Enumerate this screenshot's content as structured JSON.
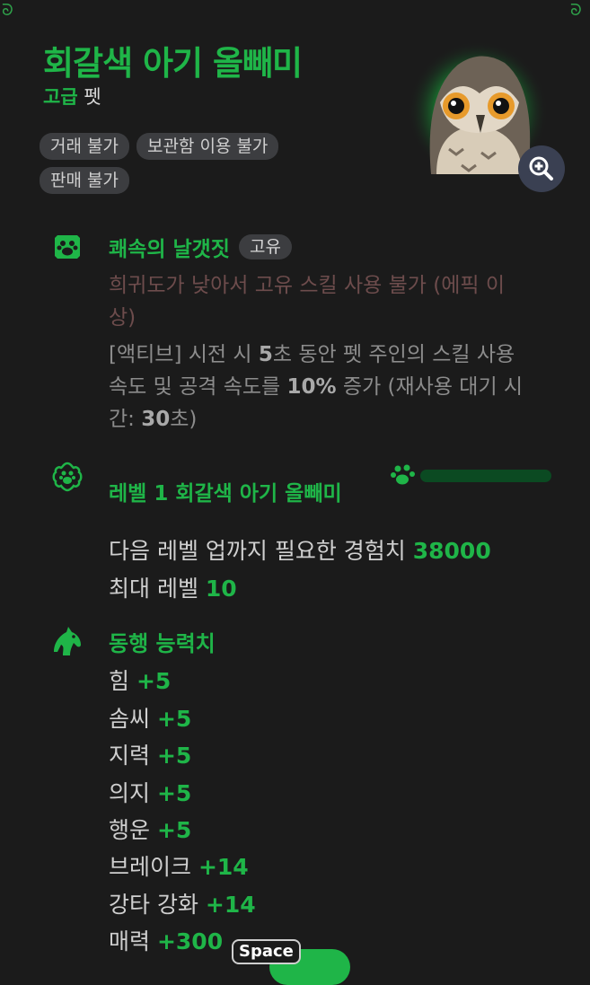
{
  "item": {
    "name": "회갈색 아기 올빼미",
    "grade": "고급",
    "type": "펫",
    "tags": [
      "거래 불가",
      "보관함 이용 불가",
      "판매 불가"
    ]
  },
  "skill": {
    "name": "쾌속의 날갯짓",
    "badge": "고유",
    "warning": "희귀도가 낮아서 고유 스킬 사용 불가 (에픽 이상)",
    "desc_prefix": "[액티브] 시전 시 ",
    "duration": "5",
    "desc_mid1": "초 동안 펫 주인의 스킬 사용 속도 및 공격 속도를 ",
    "percent": "10%",
    "desc_mid2": " 증가 (재사용 대기 시간: ",
    "cooldown": "30",
    "desc_suffix": "초)"
  },
  "level": {
    "title": "레벨 1 회갈색 아기 올빼미",
    "exp_fill": 0,
    "next_label": "다음 레벨 업까지 필요한 경험치",
    "next_value": "38000",
    "max_label": "최대 레벨",
    "max_value": "10"
  },
  "stats": {
    "title": "동행 능력치",
    "items": [
      {
        "label": "힘",
        "value": "+5"
      },
      {
        "label": "솜씨",
        "value": "+5"
      },
      {
        "label": "지력",
        "value": "+5"
      },
      {
        "label": "의지",
        "value": "+5"
      },
      {
        "label": "행운",
        "value": "+5"
      },
      {
        "label": "브레이크",
        "value": "+14"
      },
      {
        "label": "강타 강화",
        "value": "+14"
      },
      {
        "label": "매력",
        "value": "+300"
      }
    ]
  },
  "hint": {
    "key": "Space"
  },
  "icons": {
    "zoom": "zoom-in-icon",
    "skill": "paw-badge-icon",
    "level": "paw-flower-icon",
    "stats": "horse-icon"
  },
  "colors": {
    "accent": "#1fb548",
    "background": "#1b1b1b",
    "warning": "#6d4c4c"
  }
}
